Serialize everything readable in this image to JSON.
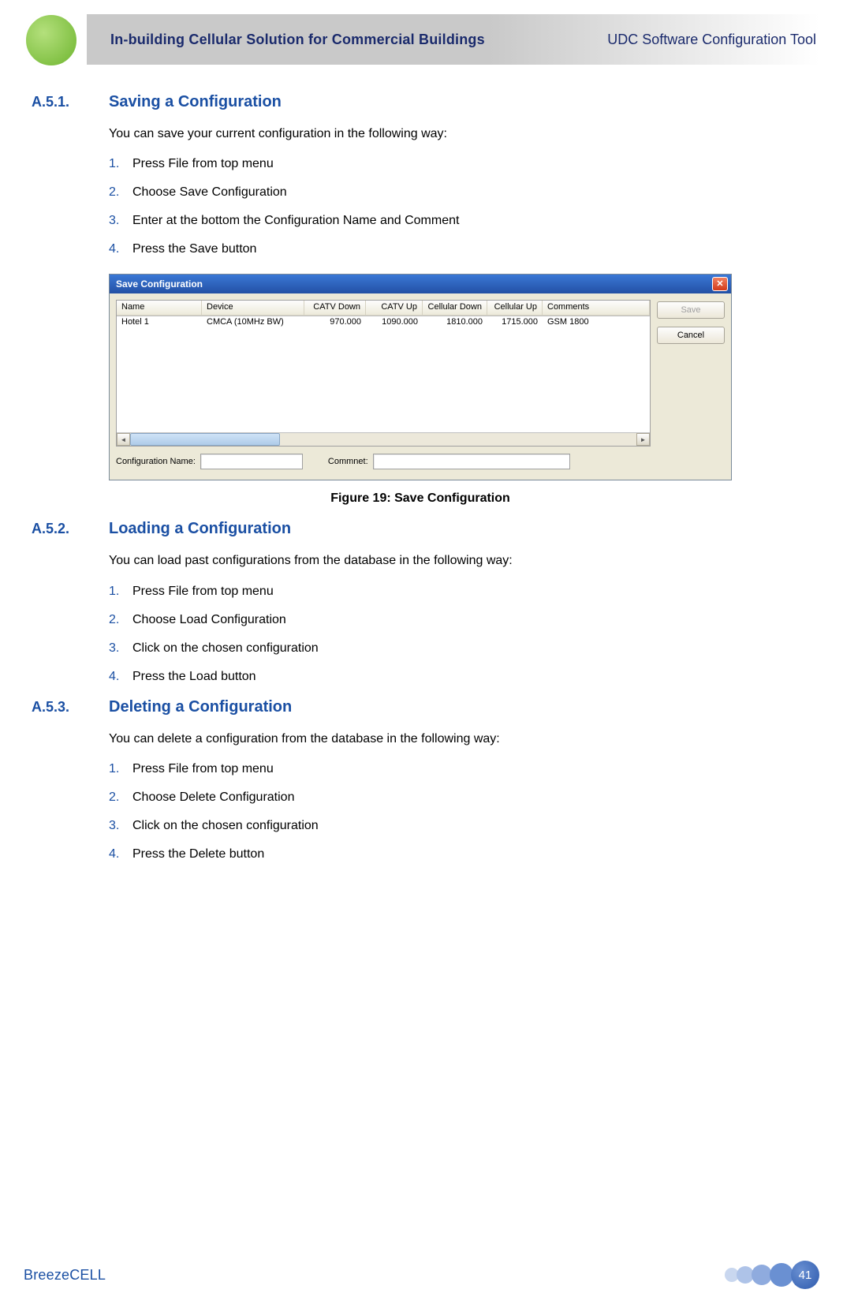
{
  "header": {
    "left": "In-building Cellular Solution for Commercial Buildings",
    "right": "UDC Software Configuration Tool"
  },
  "sections": [
    {
      "num": "A.5.1.",
      "title": "Saving a Configuration",
      "intro": "You can save your current configuration in the following way:",
      "steps": [
        "Press File from top menu",
        "Choose Save Configuration",
        "Enter at the bottom the Configuration Name and Comment",
        "Press the Save button"
      ]
    },
    {
      "num": "A.5.2.",
      "title": "Loading a Configuration",
      "intro": "You can load past configurations from the database in the following way:",
      "steps": [
        "Press File from top menu",
        "Choose Load Configuration",
        "Click on the chosen configuration",
        "Press the Load button"
      ]
    },
    {
      "num": "A.5.3.",
      "title": "Deleting a Configuration",
      "intro": "You can delete a configuration from the database in the following way:",
      "steps": [
        "Press File from top menu",
        "Choose Delete Configuration",
        "Click on the chosen configuration",
        "Press the Delete button"
      ]
    }
  ],
  "figure": {
    "caption": "Figure 19: Save Configuration"
  },
  "dialog": {
    "title": "Save Configuration",
    "columns": [
      "Name",
      "Device",
      "CATV Down",
      "CATV Up",
      "Cellular Down",
      "Cellular Up",
      "Comments"
    ],
    "rows": [
      [
        "Hotel 1",
        "CMCA (10MHz BW)",
        "970.000",
        "1090.000",
        "1810.000",
        "1715.000",
        "GSM 1800"
      ]
    ],
    "config_name_label": "Configuration Name:",
    "comment_label": "Commnet:",
    "save_btn": "Save",
    "cancel_btn": "Cancel"
  },
  "footer": {
    "brand": "BreezeCELL",
    "page": "41"
  }
}
